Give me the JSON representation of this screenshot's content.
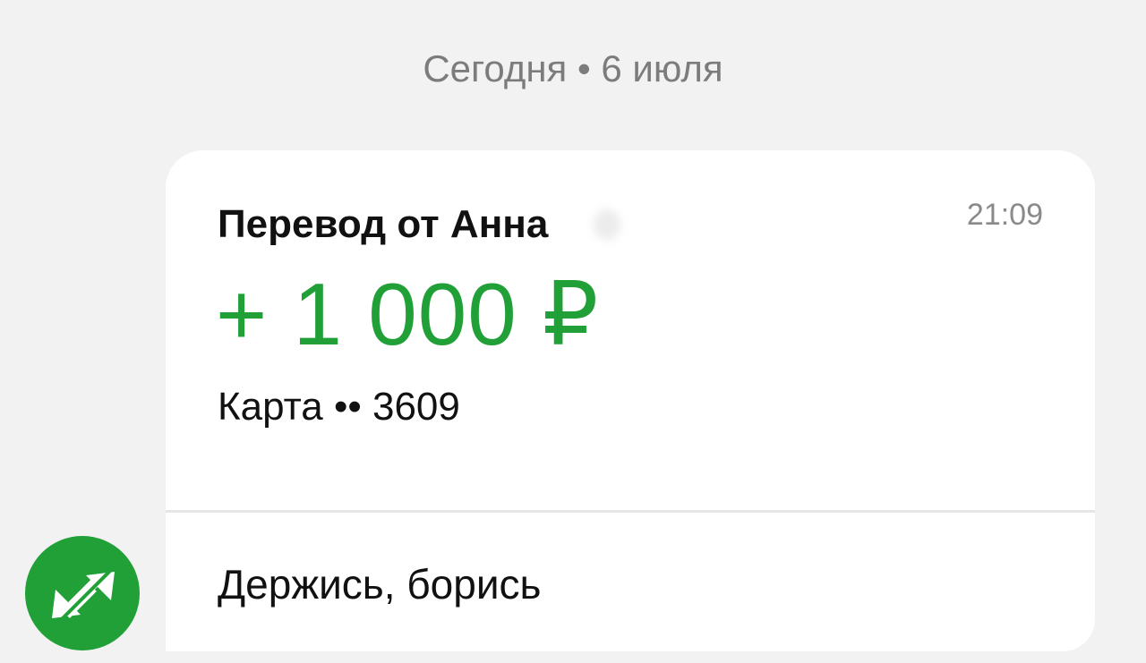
{
  "date_header": "Сегодня • 6 июля",
  "transfer": {
    "title": "Перевод от Анна",
    "time": "21:09",
    "amount": "+ 1 000 ₽",
    "card": "Карта •• 3609",
    "message": "Держись, борись"
  },
  "icons": {
    "avatar": "transfer-arrows-icon"
  },
  "colors": {
    "accent_green": "#21a038",
    "background": "#f2f2f2",
    "card": "#ffffff",
    "muted_text": "#7c7c7c"
  }
}
